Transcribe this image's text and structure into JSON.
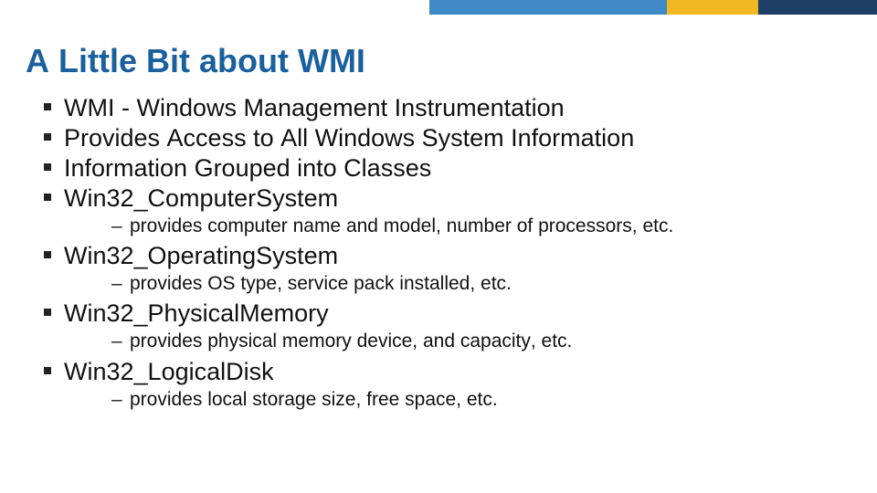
{
  "accent": {
    "blue": "#3f89c7",
    "yellow": "#f2b824",
    "navy": "#1f3f66"
  },
  "title": "A Little Bit about WMI",
  "bullets": [
    {
      "label": "WMI - Windows Management Instrumentation"
    },
    {
      "label": "Provides Access to All Windows System Information"
    },
    {
      "label": "Information Grouped into Classes"
    },
    {
      "label": "Win32_ComputerSystem",
      "sub": "provides computer name and model, number of processors, etc."
    },
    {
      "label": "Win32_OperatingSystem",
      "sub": "provides OS type, service pack installed, etc."
    },
    {
      "label": "Win32_PhysicalMemory",
      "sub": "provides physical memory device, and capacity, etc."
    },
    {
      "label": "Win32_LogicalDisk",
      "sub": "provides local storage size, free space, etc."
    }
  ]
}
